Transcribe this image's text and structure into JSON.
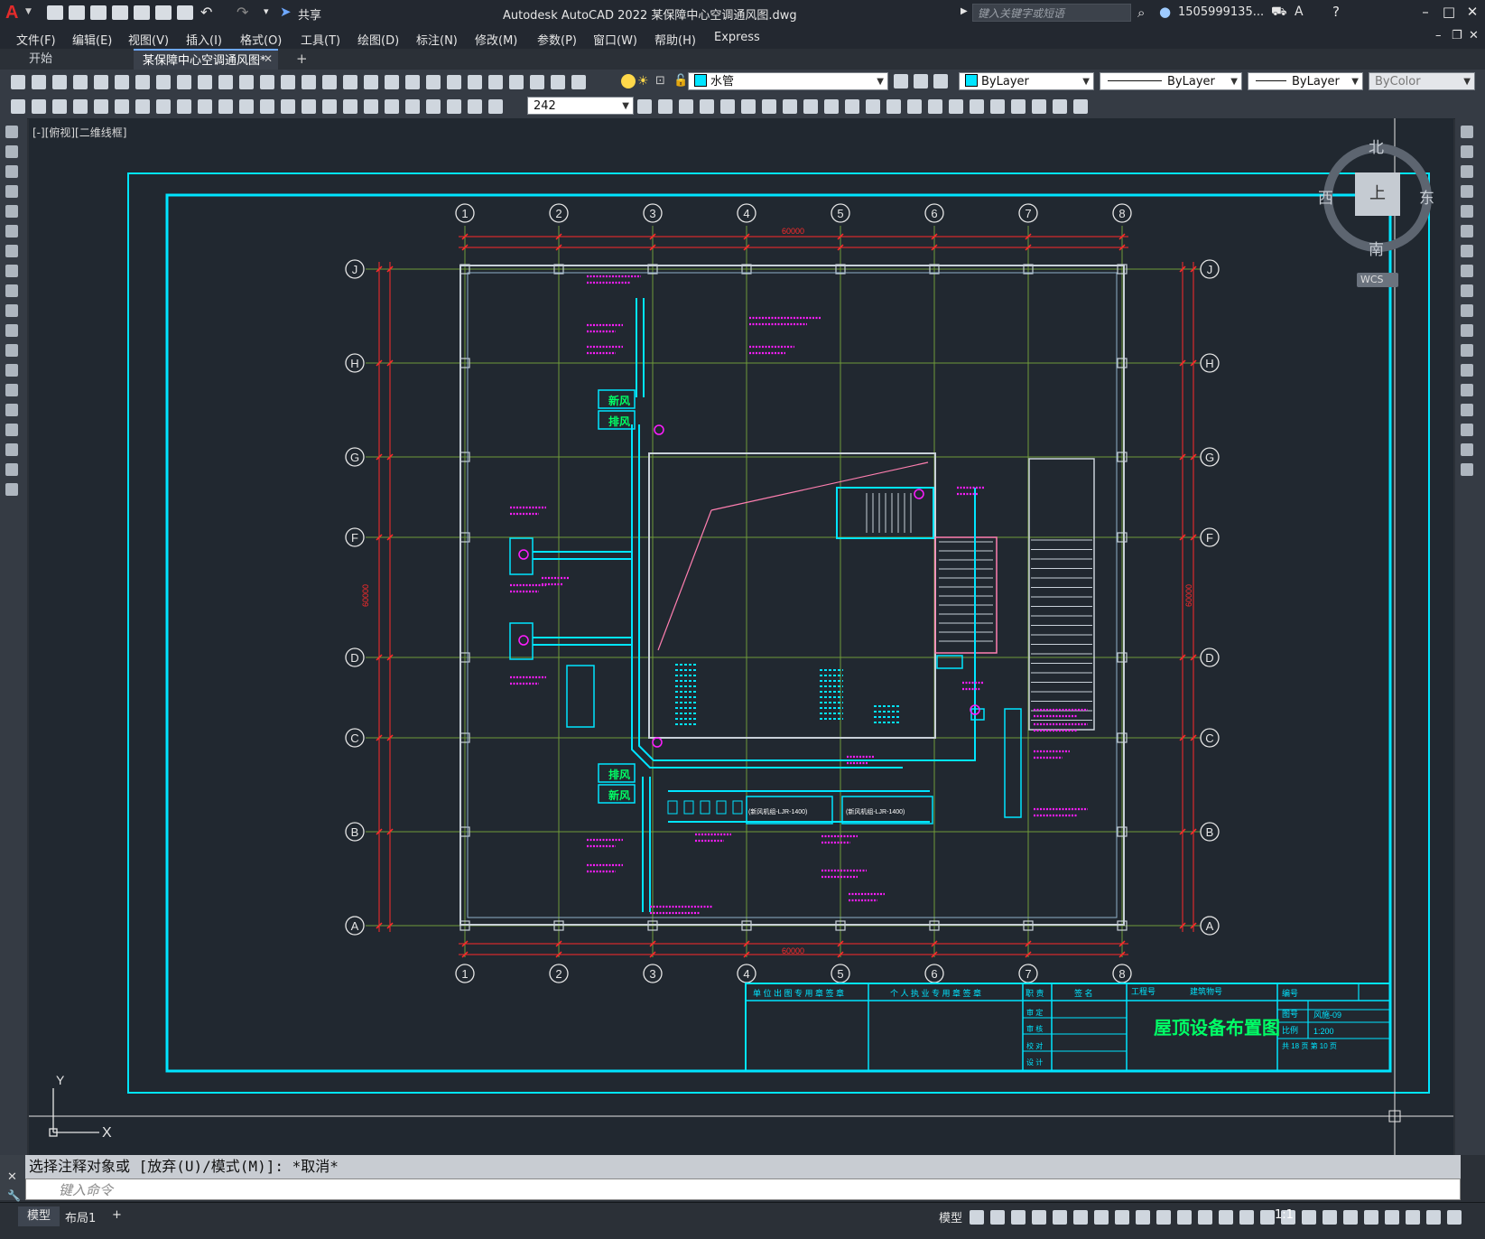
{
  "titlebar": {
    "share": "共享",
    "title": "Autodesk AutoCAD 2022    某保障中心空调通风图.dwg",
    "search_placeholder": "键入关键字或短语",
    "user": "1505999135..."
  },
  "menu": [
    "文件(F)",
    "编辑(E)",
    "视图(V)",
    "插入(I)",
    "格式(O)",
    "工具(T)",
    "绘图(D)",
    "标注(N)",
    "修改(M)",
    "参数(P)",
    "窗口(W)",
    "帮助(H)",
    "Express"
  ],
  "tabs": {
    "start": "开始",
    "doc": "某保障中心空调通风图*",
    "close": "✕",
    "add": "+"
  },
  "toolbar": {
    "layer": "水管",
    "color": "ByLayer",
    "linetype": "ByLayer",
    "lineweight": "ByLayer",
    "plotstyle": "ByColor",
    "dimstyle_value": "242",
    "layer_color": "#00e5ff",
    "color_swatch": "#00e5ff"
  },
  "viewport": {
    "label": "[-][俯视][二维线框]"
  },
  "viewcube": {
    "north": "北",
    "south": "南",
    "east": "东",
    "west": "西",
    "top": "上",
    "wcs": "WCS"
  },
  "grid": {
    "columns": [
      "1",
      "2",
      "3",
      "4",
      "5",
      "6",
      "7",
      "8"
    ],
    "rows": [
      "J",
      "H",
      "G",
      "F",
      "D",
      "C",
      "B",
      "A"
    ],
    "overall_dim_top": "60000",
    "overall_dim_bottom": "60000",
    "overall_dim_left": "60000",
    "overall_dim_right": "60000"
  },
  "labels": {
    "fresh_air": "新风",
    "exhaust": "排风",
    "unit_a": "(新风机组-LJR-1400)",
    "unit_b": "(新风机组-LJR-1400)"
  },
  "titleblock": {
    "col_unit": "单 位 出 图 专 用 章 签 章",
    "col_personal": "个 人 执 业 专 用 章 签 章",
    "col_role": "职 责",
    "col_sign": "签 名",
    "project_no": "工程号",
    "building_no": "建筑物号",
    "number": "编号",
    "drawing_no_label": "图号",
    "drawing_no": "风施-09",
    "scale_label": "比例",
    "scale": "1:200",
    "sheets": "共  18  页  第  10  页",
    "roles": [
      "审 定",
      "审 核",
      "校 对",
      "设 计"
    ],
    "drawing_title": "屋顶设备布置图"
  },
  "ucs": {
    "x": "X",
    "y": "Y"
  },
  "command": {
    "history": "选择注释对象或 [放弃(U)/模式(M)]: *取消*",
    "placeholder": "键入命令"
  },
  "status": {
    "tab_model": "模型",
    "tab_layout": "布局1",
    "add": "+",
    "mode": "模型",
    "scale": "1:1"
  },
  "colors": {
    "frame": "#00e5ff",
    "grid_line": "#6f9a3a",
    "dimension": "#ff2a2a",
    "annotation": "#ff1dff",
    "duct": "#00e5ff",
    "wall": "#c8d0d8",
    "background": "#212830"
  }
}
